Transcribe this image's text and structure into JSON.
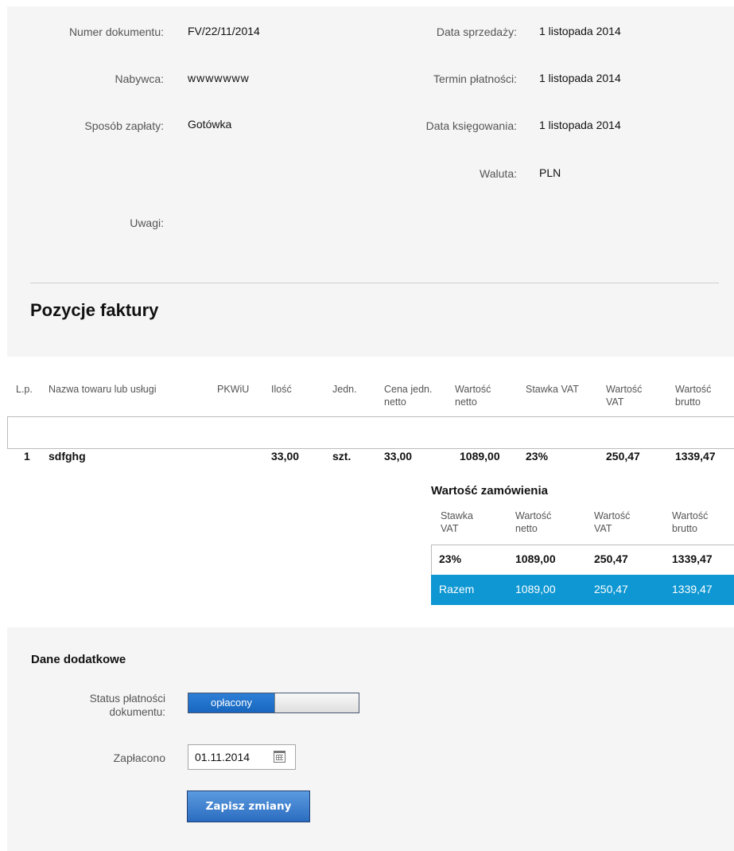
{
  "document": {
    "number_label": "Numer dokumentu:",
    "number_value": "FV/22/11/2014",
    "sale_date_label": "Data sprzedaży:",
    "sale_date_value": "1 listopada 2014",
    "buyer_label": "Nabywca:",
    "buyer_value": "wwwwwww",
    "payment_due_label": "Termin płatności:",
    "payment_due_value": "1 listopada 2014",
    "payment_method_label": "Sposób zapłaty:",
    "payment_method_value": "Gotówka",
    "booking_date_label": "Data księgowania:",
    "booking_date_value": "1 listopada 2014",
    "currency_label": "Waluta:",
    "currency_value": "PLN",
    "notes_label": "Uwagi:"
  },
  "items": {
    "title": "Pozycje faktury",
    "headers": {
      "lp": "L.p.",
      "name": "Nazwa towaru lub usługi",
      "pkwiu": "PKWiU",
      "qty": "Ilość",
      "unit": "Jedn.",
      "unit_price_1": "Cena jedn.",
      "unit_price_2": "netto",
      "net_value_1": "Wartość",
      "net_value_2": "netto",
      "vat_rate": "Stawka VAT",
      "vat_value_1": "Wartość",
      "vat_value_2": "VAT",
      "gross_value_1": "Wartość",
      "gross_value_2": "brutto"
    },
    "rows": [
      {
        "lp": "1",
        "name": "sdfghg",
        "pkwiu": "",
        "qty": "33,00",
        "unit": "szt.",
        "unit_price": "33,00",
        "net_value": "1089,00",
        "vat_rate": "23%",
        "vat_value": "250,47",
        "gross_value": "1339,47"
      }
    ]
  },
  "order_value": {
    "title": "Wartość zamówienia",
    "headers": {
      "vat_rate_1": "Stawka",
      "vat_rate_2": "VAT",
      "net_1": "Wartość",
      "net_2": "netto",
      "vat_1": "Wartość",
      "vat_2": "VAT",
      "gross_1": "Wartość",
      "gross_2": "brutto"
    },
    "rows": [
      {
        "vat_rate": "23%",
        "net": "1089,00",
        "vat": "250,47",
        "gross": "1339,47"
      }
    ],
    "total": {
      "label": "Razem",
      "net": "1089,00",
      "vat": "250,47",
      "gross": "1339,47"
    },
    "accent_color": "#0e97d2"
  },
  "extra": {
    "title": "Dane dodatkowe",
    "payment_status_label_1": "Status płatności",
    "payment_status_label_2": "dokumentu:",
    "payment_status_value": "opłacony",
    "paid_label": "Zapłacono",
    "paid_date": "01.11.2014",
    "save_label": "Zapisz zmiany"
  }
}
